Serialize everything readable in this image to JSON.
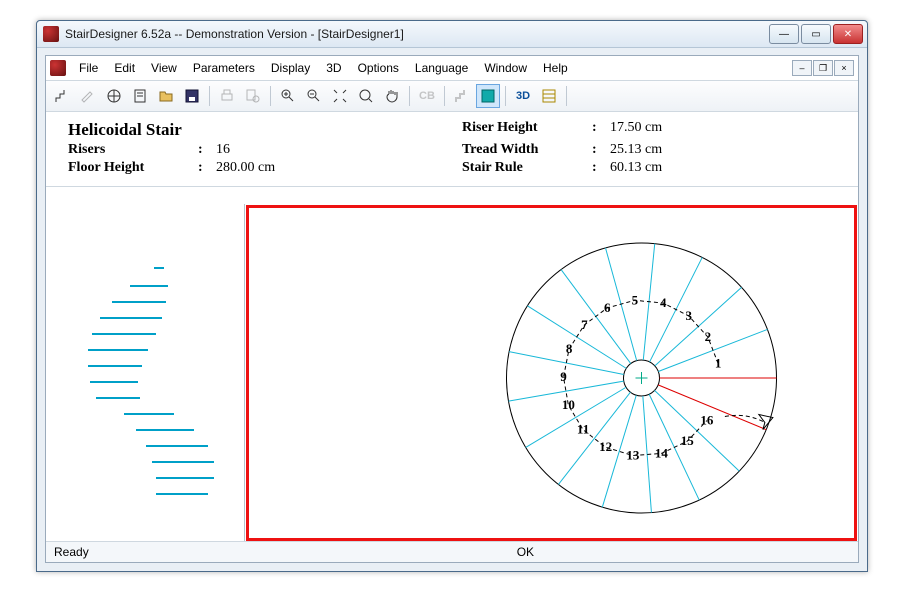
{
  "window": {
    "title": "StairDesigner 6.52a -- Demonstration Version - [StairDesigner1]"
  },
  "menu": {
    "items": [
      "File",
      "Edit",
      "View",
      "Parameters",
      "Display",
      "3D",
      "Options",
      "Language",
      "Window",
      "Help"
    ]
  },
  "toolbar": {
    "btn_3d": "3D",
    "btn_cb": "CB"
  },
  "info": {
    "title": "Helicoidal Stair",
    "risers_label": "Risers",
    "risers_value": "16",
    "floor_height_label": "Floor Height",
    "floor_height_value": "280.00 cm",
    "riser_height_label": "Riser Height",
    "riser_height_value": "17.50 cm",
    "tread_width_label": "Tread Width",
    "tread_width_value": "25.13 cm",
    "stair_rule_label": "Stair Rule",
    "stair_rule_value": "60.13 cm"
  },
  "plan": {
    "step_labels": [
      "1",
      "2",
      "3",
      "4",
      "5",
      "6",
      "7",
      "8",
      "9",
      "10",
      "11",
      "12",
      "13",
      "14",
      "15",
      "16"
    ]
  },
  "status": {
    "ready": "Ready",
    "ok": "OK"
  },
  "colon": ":"
}
